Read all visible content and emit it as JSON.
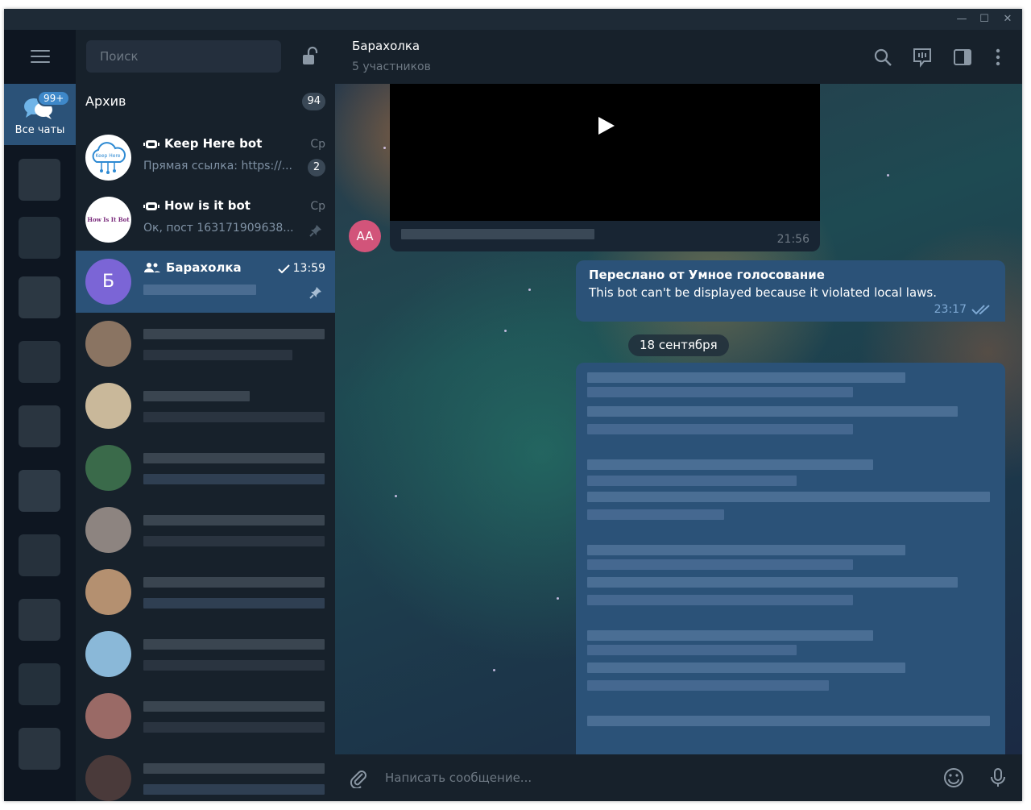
{
  "window": {
    "controls": {
      "minimize": "—",
      "maximize": "☐",
      "close": "✕"
    }
  },
  "folders": {
    "all_chats": {
      "label": "Все чаты",
      "badge": "99+"
    }
  },
  "search": {
    "placeholder": "Поиск"
  },
  "archive": {
    "label": "Архив",
    "count": "94"
  },
  "chats": [
    {
      "title": "Keep Here bot",
      "time": "Ср",
      "preview": "Прямая ссылка: https://...",
      "unread": "2",
      "avatar_text": "Keep Here",
      "is_bot": true
    },
    {
      "title": "How is it bot",
      "time": "Ср",
      "preview": "Ок, пост 163171909638...",
      "avatar_text": "How Is It Bot",
      "is_bot": true,
      "pinned": true
    },
    {
      "title": "Барахолка",
      "time": "13:59",
      "avatar_letter": "Б",
      "is_group": true,
      "pinned": true,
      "active": true
    }
  ],
  "header": {
    "title": "Барахолка",
    "subtitle": "5 участников"
  },
  "messages": {
    "video": {
      "time": "21:56"
    },
    "sender_avatar": "AA",
    "forwarded": {
      "title": "Переслано от Умное голосование",
      "text": "This bot can't be displayed because it violated local laws.",
      "time": "23:17"
    },
    "date_separator": "18 сентября"
  },
  "composer": {
    "placeholder": "Написать сообщение..."
  },
  "colors": {
    "sidebar": "#0e1621",
    "panel": "#17212b",
    "active": "#2b5278",
    "accent": "#3e88c9",
    "outgoing_bubble": "#2b5278",
    "avatar_purple": "#7b65d6",
    "avatar_pink": "#d2547a"
  }
}
